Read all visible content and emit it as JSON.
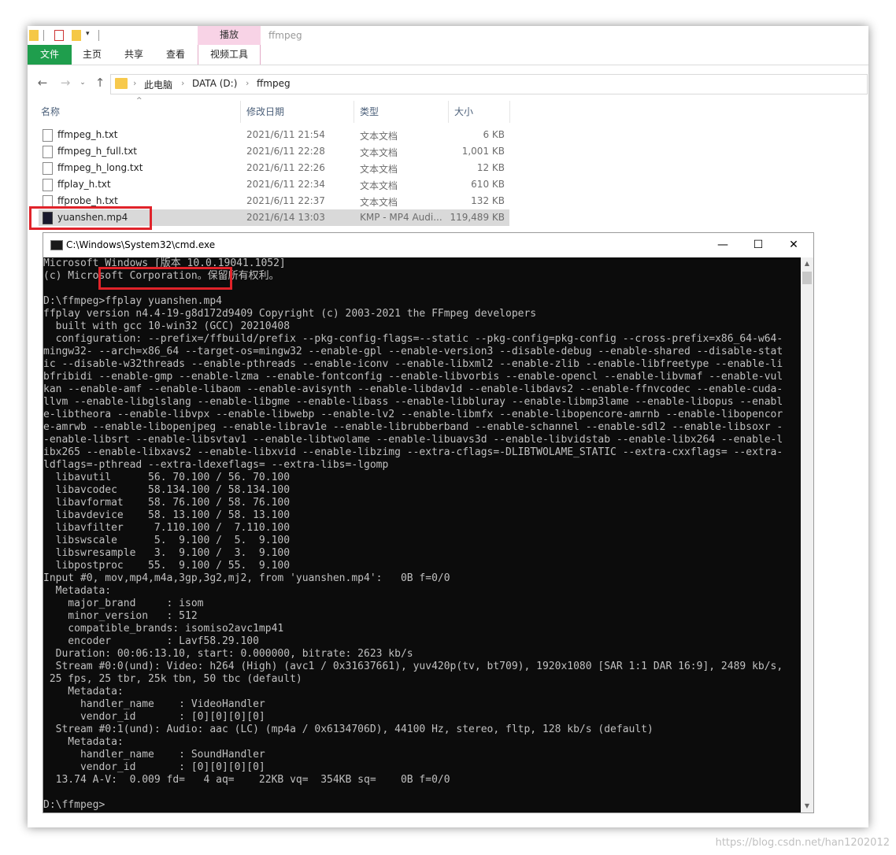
{
  "explorer": {
    "window_title": "ffmpeg",
    "context_tab": "播放",
    "tabs": [
      "文件",
      "主页",
      "共享",
      "查看",
      "视频工具"
    ],
    "breadcrumb": [
      "此电脑",
      "DATA (D:)",
      "ffmpeg"
    ],
    "columns": [
      "名称",
      "修改日期",
      "类型",
      "大小"
    ],
    "files": [
      {
        "name": "ffmpeg_h.txt",
        "date": "2021/6/11 21:54",
        "type": "文本文档",
        "size": "6 KB"
      },
      {
        "name": "ffmpeg_h_full.txt",
        "date": "2021/6/11 22:28",
        "type": "文本文档",
        "size": "1,001 KB"
      },
      {
        "name": "ffmpeg_h_long.txt",
        "date": "2021/6/11 22:26",
        "type": "文本文档",
        "size": "12 KB"
      },
      {
        "name": "ffplay_h.txt",
        "date": "2021/6/11 22:34",
        "type": "文本文档",
        "size": "610 KB"
      },
      {
        "name": "ffprobe_h.txt",
        "date": "2021/6/11 22:37",
        "type": "文本文档",
        "size": "132 KB"
      },
      {
        "name": "yuanshen.mp4",
        "date": "2021/6/14 13:03",
        "type": "KMP - MP4 Audi...",
        "size": "119,489 KB"
      }
    ]
  },
  "cmd": {
    "title": "C:\\Windows\\System32\\cmd.exe",
    "lines": [
      "Microsoft Windows [版本 10.0.19041.1052]",
      "(c) Microsoft Corporation。保留所有权利。",
      "",
      "D:\\ffmpeg>ffplay yuanshen.mp4",
      "ffplay version n4.4-19-g8d172d9409 Copyright (c) 2003-2021 the FFmpeg developers",
      "  built with gcc 10-win32 (GCC) 20210408",
      "  configuration: --prefix=/ffbuild/prefix --pkg-config-flags=--static --pkg-config=pkg-config --cross-prefix=x86_64-w64-",
      "mingw32- --arch=x86_64 --target-os=mingw32 --enable-gpl --enable-version3 --disable-debug --enable-shared --disable-stat",
      "ic --disable-w32threads --enable-pthreads --enable-iconv --enable-libxml2 --enable-zlib --enable-libfreetype --enable-li",
      "bfribidi --enable-gmp --enable-lzma --enable-fontconfig --enable-libvorbis --enable-opencl --enable-libvmaf --enable-vul",
      "kan --enable-amf --enable-libaom --enable-avisynth --enable-libdav1d --enable-libdavs2 --enable-ffnvcodec --enable-cuda-",
      "llvm --enable-libglslang --enable-libgme --enable-libass --enable-libbluray --enable-libmp3lame --enable-libopus --enabl",
      "e-libtheora --enable-libvpx --enable-libwebp --enable-lv2 --enable-libmfx --enable-libopencore-amrnb --enable-libopencor",
      "e-amrwb --enable-libopenjpeg --enable-librav1e --enable-librubberband --enable-schannel --enable-sdl2 --enable-libsoxr -",
      "-enable-libsrt --enable-libsvtav1 --enable-libtwolame --enable-libuavs3d --enable-libvidstab --enable-libx264 --enable-l",
      "ibx265 --enable-libxavs2 --enable-libxvid --enable-libzimg --extra-cflags=-DLIBTWOLAME_STATIC --extra-cxxflags= --extra-",
      "ldflags=-pthread --extra-ldexeflags= --extra-libs=-lgomp",
      "  libavutil      56. 70.100 / 56. 70.100",
      "  libavcodec     58.134.100 / 58.134.100",
      "  libavformat    58. 76.100 / 58. 76.100",
      "  libavdevice    58. 13.100 / 58. 13.100",
      "  libavfilter     7.110.100 /  7.110.100",
      "  libswscale      5.  9.100 /  5.  9.100",
      "  libswresample   3.  9.100 /  3.  9.100",
      "  libpostproc    55.  9.100 / 55.  9.100",
      "Input #0, mov,mp4,m4a,3gp,3g2,mj2, from 'yuanshen.mp4':   0B f=0/0",
      "  Metadata:",
      "    major_brand     : isom",
      "    minor_version   : 512",
      "    compatible_brands: isomiso2avc1mp41",
      "    encoder         : Lavf58.29.100",
      "  Duration: 00:06:13.10, start: 0.000000, bitrate: 2623 kb/s",
      "  Stream #0:0(und): Video: h264 (High) (avc1 / 0x31637661), yuv420p(tv, bt709), 1920x1080 [SAR 1:1 DAR 16:9], 2489 kb/s,",
      " 25 fps, 25 tbr, 25k tbn, 50 tbc (default)",
      "    Metadata:",
      "      handler_name    : VideoHandler",
      "      vendor_id       : [0][0][0][0]",
      "  Stream #0:1(und): Audio: aac (LC) (mp4a / 0x6134706D), 44100 Hz, stereo, fltp, 128 kb/s (default)",
      "    Metadata:",
      "      handler_name    : SoundHandler",
      "      vendor_id       : [0][0][0][0]",
      "  13.74 A-V:  0.009 fd=   4 aq=    22KB vq=  354KB sq=    0B f=0/0",
      "",
      "D:\\ffmpeg>"
    ]
  },
  "watermark": "https://blog.csdn.net/han1202012"
}
